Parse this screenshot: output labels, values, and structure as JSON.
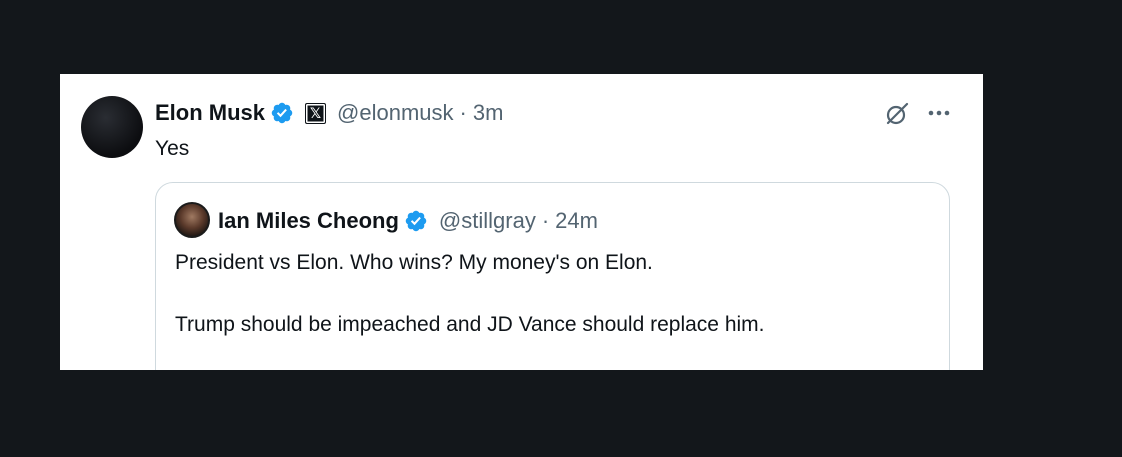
{
  "tweet": {
    "author_name": "Elon Musk",
    "handle": "@elonmusk",
    "separator": "·",
    "time": "3m",
    "text": "Yes",
    "icons": {
      "verified": "verified-badge-icon",
      "affiliation": "x-logo-icon",
      "grok": "grok-icon",
      "more": "more-options-icon"
    }
  },
  "quoted_tweet": {
    "author_name": "Ian Miles Cheong",
    "handle": "@stillgray",
    "separator": "·",
    "time": "24m",
    "text_line1": "President vs Elon. Who wins? My money's on Elon.",
    "text_line2": "Trump should be impeached and JD Vance should replace him."
  },
  "colors": {
    "background": "#13171b",
    "card": "#ffffff",
    "verified_blue": "#1d9bf0",
    "secondary_text": "#536471",
    "primary_text": "#0f1419"
  }
}
